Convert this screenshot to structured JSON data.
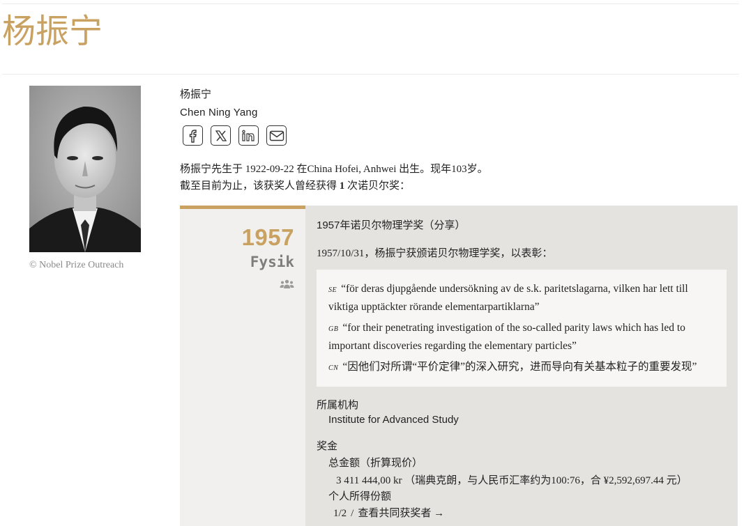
{
  "page": {
    "title": "杨振宁"
  },
  "portrait": {
    "alt": "Chen Ning Yang portrait",
    "credit": "© Nobel Prize Outreach"
  },
  "laureate": {
    "name_cn": "杨振宁",
    "name_en": "Chen Ning Yang"
  },
  "share_icons": [
    "facebook-icon",
    "x-icon",
    "linkedin-icon",
    "mail-icon"
  ],
  "bio": {
    "line1": "杨振宁先生于 1922-09-22  在China Hofei, Anhwei 出生。现年103岁。",
    "line2_prefix": "截至目前为止，该获奖人曾经获得 ",
    "count": "1",
    "line2_suffix": " 次诺贝尔奖："
  },
  "award": {
    "year": "1957",
    "category": "Fysik",
    "icon": "people-icon",
    "title": "1957年诺贝尔物理学奖（分享）",
    "award_line": "1957/10/31，杨振宁获颁诺贝尔物理学奖，以表彰：",
    "motivations": {
      "se_code": "SE",
      "se": "“för deras djupgående undersökning av de s.k. paritetslagarna, vilken har lett till viktiga upptäckter rörande elementarpartiklarna”",
      "gb_code": "GB",
      "gb": "“for their penetrating investigation of the so-called parity laws which has led to important discoveries regarding the elementary particles”",
      "cn_code": "CN",
      "cn": "“因他们对所谓“平价定律”的深入研究，进而导向有关基本粒子的重要发现”"
    },
    "affiliation_heading": "所属机构",
    "affiliation": "Institute for Advanced Study",
    "prize_heading": "奖金",
    "total_heading": "总金额（折算现价）",
    "total_value": "3 411 444,00 kr （瑞典克朗，与人民币汇率约为100:76，合 ¥2,592,697.44 元）",
    "share_heading": "个人所得份额",
    "share_value": "1/2",
    "share_sep": "/",
    "co_laureates_link": "查看共同获奖者 →"
  },
  "colors": {
    "accent": "#c9a262",
    "panel_left": "#f1f0ee",
    "panel_right": "#e4e3e0",
    "quote_box": "#f7f6f4"
  }
}
